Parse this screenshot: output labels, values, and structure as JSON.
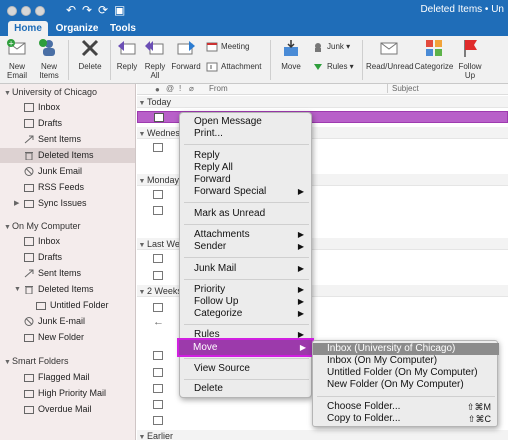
{
  "window": {
    "title": "Deleted Items • Un"
  },
  "tabs": [
    {
      "label": "Home",
      "active": true
    },
    {
      "label": "Organize",
      "active": false
    },
    {
      "label": "Tools",
      "active": false
    }
  ],
  "ribbon": {
    "new_email": "New\nEmail",
    "new_items": "New\nItems",
    "delete": "Delete",
    "reply": "Reply",
    "reply_all": "Reply\nAll",
    "forward": "Forward",
    "meeting": "Meeting",
    "attachment": "Attachment",
    "move": "Move",
    "junk": "Junk",
    "rules": "Rules",
    "read_unread": "Read/Unread",
    "categorize": "Categorize",
    "follow_up": "Follow\nUp"
  },
  "sidebar": {
    "account1": "University of Chicago",
    "account1_items": [
      "Inbox",
      "Drafts",
      "Sent Items",
      "Deleted Items",
      "Junk Email",
      "RSS Feeds",
      "Sync Issues"
    ],
    "account2": "On My Computer",
    "account2_items": [
      "Inbox",
      "Drafts",
      "Sent Items",
      "Deleted Items",
      "Untitled Folder",
      "Junk E-mail",
      "New Folder"
    ],
    "smart": "Smart Folders",
    "smart_items": [
      "Flagged Mail",
      "High Priority Mail",
      "Overdue Mail"
    ]
  },
  "list": {
    "col_from": "From",
    "col_subject": "Subject",
    "groups": [
      "Today",
      "Wednes",
      "Monday",
      "Last We",
      "2 Weeks",
      "Earlier"
    ]
  },
  "context_menu": {
    "open_message": "Open Message",
    "print": "Print...",
    "reply": "Reply",
    "reply_all": "Reply All",
    "forward": "Forward",
    "forward_special": "Forward Special",
    "mark_unread": "Mark as Unread",
    "attachments": "Attachments",
    "sender": "Sender",
    "junk_mail": "Junk Mail",
    "priority": "Priority",
    "follow_up": "Follow Up",
    "categorize": "Categorize",
    "rules": "Rules",
    "move": "Move",
    "view_source": "View Source",
    "delete": "Delete"
  },
  "submenu": {
    "items": [
      "Inbox (University of Chicago)",
      "Inbox (On My Computer)",
      "Untitled Folder (On My Computer)",
      "New Folder (On My Computer)"
    ],
    "choose_folder": "Choose Folder...",
    "choose_shortcut": "⇧⌘M",
    "copy_folder": "Copy to Folder...",
    "copy_shortcut": "⇧⌘C"
  },
  "colors": {
    "titlebar": "#1f6db8",
    "highlight": "#9c3aab",
    "selected_row": "#b860c9"
  }
}
